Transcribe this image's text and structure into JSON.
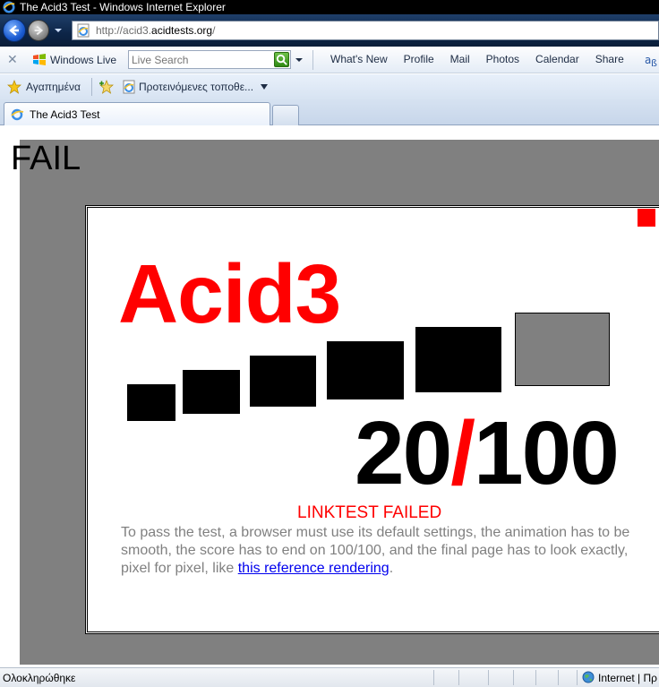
{
  "window": {
    "title": "The Acid3 Test - Windows Internet Explorer"
  },
  "address_bar": {
    "url_prefix": "http://acid3.",
    "url_domain": "acidtests.org",
    "url_suffix": "/"
  },
  "command_bar": {
    "windows_live": "Windows Live",
    "search_placeholder": "Live Search",
    "links": [
      "What's New",
      "Profile",
      "Mail",
      "Photos",
      "Calendar",
      "Share"
    ]
  },
  "favorites_bar": {
    "favorites_label": "Αγαπημένα",
    "suggested_label": "Προτεινόμενες τοποθε..."
  },
  "tabs": [
    {
      "label": "The Acid3 Test",
      "active": true
    }
  ],
  "page": {
    "fail_text": "FAIL",
    "acid_title": "Acid3",
    "score_value": "20",
    "score_slash": "/",
    "score_total": "100",
    "linktest_status": "LINKTEST FAILED",
    "instructions_text": "To pass the test, a browser must use its default settings, the animation has to be smooth, the score has to end on 100/100, and the final page has to look exactly, pixel for pixel, like ",
    "reference_link": "this reference rendering",
    "instructions_end": "."
  },
  "status_bar": {
    "status_text": "Ολοκληρώθηκε",
    "zone_text": "Internet | Πρ"
  },
  "colors": {
    "fail_red": "#ff0000",
    "gray": "#808080",
    "link_blue": "#0000ee",
    "titlebar": "#000000"
  }
}
